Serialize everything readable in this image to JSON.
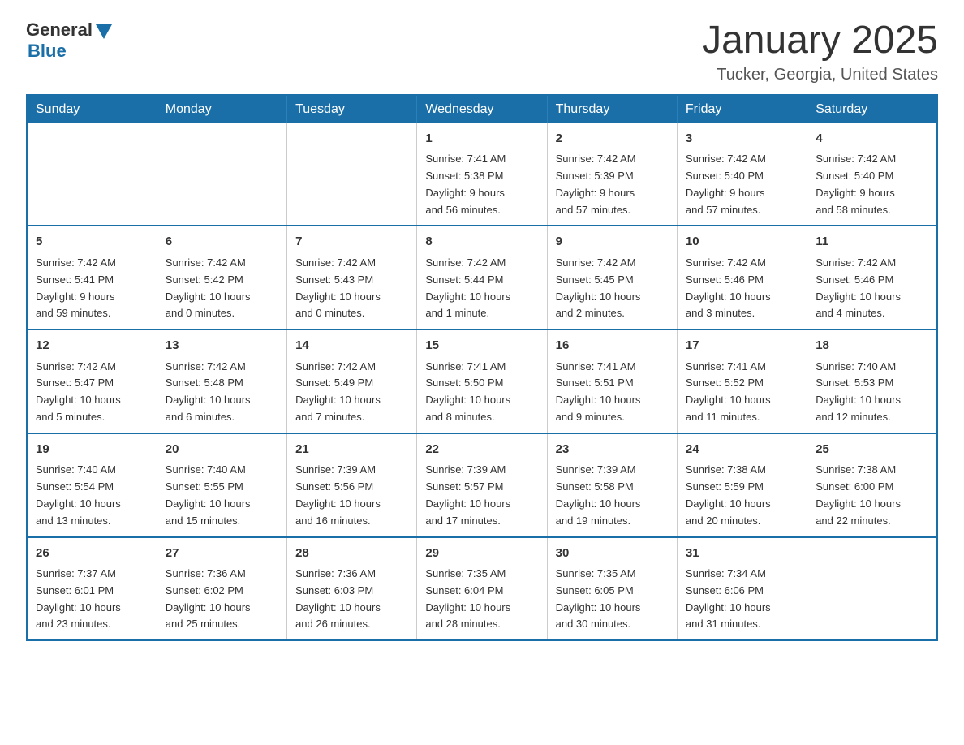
{
  "logo": {
    "general": "General",
    "blue": "Blue"
  },
  "header": {
    "title": "January 2025",
    "location": "Tucker, Georgia, United States"
  },
  "weekdays": [
    "Sunday",
    "Monday",
    "Tuesday",
    "Wednesday",
    "Thursday",
    "Friday",
    "Saturday"
  ],
  "weeks": [
    [
      {
        "day": "",
        "info": ""
      },
      {
        "day": "",
        "info": ""
      },
      {
        "day": "",
        "info": ""
      },
      {
        "day": "1",
        "info": "Sunrise: 7:41 AM\nSunset: 5:38 PM\nDaylight: 9 hours\nand 56 minutes."
      },
      {
        "day": "2",
        "info": "Sunrise: 7:42 AM\nSunset: 5:39 PM\nDaylight: 9 hours\nand 57 minutes."
      },
      {
        "day": "3",
        "info": "Sunrise: 7:42 AM\nSunset: 5:40 PM\nDaylight: 9 hours\nand 57 minutes."
      },
      {
        "day": "4",
        "info": "Sunrise: 7:42 AM\nSunset: 5:40 PM\nDaylight: 9 hours\nand 58 minutes."
      }
    ],
    [
      {
        "day": "5",
        "info": "Sunrise: 7:42 AM\nSunset: 5:41 PM\nDaylight: 9 hours\nand 59 minutes."
      },
      {
        "day": "6",
        "info": "Sunrise: 7:42 AM\nSunset: 5:42 PM\nDaylight: 10 hours\nand 0 minutes."
      },
      {
        "day": "7",
        "info": "Sunrise: 7:42 AM\nSunset: 5:43 PM\nDaylight: 10 hours\nand 0 minutes."
      },
      {
        "day": "8",
        "info": "Sunrise: 7:42 AM\nSunset: 5:44 PM\nDaylight: 10 hours\nand 1 minute."
      },
      {
        "day": "9",
        "info": "Sunrise: 7:42 AM\nSunset: 5:45 PM\nDaylight: 10 hours\nand 2 minutes."
      },
      {
        "day": "10",
        "info": "Sunrise: 7:42 AM\nSunset: 5:46 PM\nDaylight: 10 hours\nand 3 minutes."
      },
      {
        "day": "11",
        "info": "Sunrise: 7:42 AM\nSunset: 5:46 PM\nDaylight: 10 hours\nand 4 minutes."
      }
    ],
    [
      {
        "day": "12",
        "info": "Sunrise: 7:42 AM\nSunset: 5:47 PM\nDaylight: 10 hours\nand 5 minutes."
      },
      {
        "day": "13",
        "info": "Sunrise: 7:42 AM\nSunset: 5:48 PM\nDaylight: 10 hours\nand 6 minutes."
      },
      {
        "day": "14",
        "info": "Sunrise: 7:42 AM\nSunset: 5:49 PM\nDaylight: 10 hours\nand 7 minutes."
      },
      {
        "day": "15",
        "info": "Sunrise: 7:41 AM\nSunset: 5:50 PM\nDaylight: 10 hours\nand 8 minutes."
      },
      {
        "day": "16",
        "info": "Sunrise: 7:41 AM\nSunset: 5:51 PM\nDaylight: 10 hours\nand 9 minutes."
      },
      {
        "day": "17",
        "info": "Sunrise: 7:41 AM\nSunset: 5:52 PM\nDaylight: 10 hours\nand 11 minutes."
      },
      {
        "day": "18",
        "info": "Sunrise: 7:40 AM\nSunset: 5:53 PM\nDaylight: 10 hours\nand 12 minutes."
      }
    ],
    [
      {
        "day": "19",
        "info": "Sunrise: 7:40 AM\nSunset: 5:54 PM\nDaylight: 10 hours\nand 13 minutes."
      },
      {
        "day": "20",
        "info": "Sunrise: 7:40 AM\nSunset: 5:55 PM\nDaylight: 10 hours\nand 15 minutes."
      },
      {
        "day": "21",
        "info": "Sunrise: 7:39 AM\nSunset: 5:56 PM\nDaylight: 10 hours\nand 16 minutes."
      },
      {
        "day": "22",
        "info": "Sunrise: 7:39 AM\nSunset: 5:57 PM\nDaylight: 10 hours\nand 17 minutes."
      },
      {
        "day": "23",
        "info": "Sunrise: 7:39 AM\nSunset: 5:58 PM\nDaylight: 10 hours\nand 19 minutes."
      },
      {
        "day": "24",
        "info": "Sunrise: 7:38 AM\nSunset: 5:59 PM\nDaylight: 10 hours\nand 20 minutes."
      },
      {
        "day": "25",
        "info": "Sunrise: 7:38 AM\nSunset: 6:00 PM\nDaylight: 10 hours\nand 22 minutes."
      }
    ],
    [
      {
        "day": "26",
        "info": "Sunrise: 7:37 AM\nSunset: 6:01 PM\nDaylight: 10 hours\nand 23 minutes."
      },
      {
        "day": "27",
        "info": "Sunrise: 7:36 AM\nSunset: 6:02 PM\nDaylight: 10 hours\nand 25 minutes."
      },
      {
        "day": "28",
        "info": "Sunrise: 7:36 AM\nSunset: 6:03 PM\nDaylight: 10 hours\nand 26 minutes."
      },
      {
        "day": "29",
        "info": "Sunrise: 7:35 AM\nSunset: 6:04 PM\nDaylight: 10 hours\nand 28 minutes."
      },
      {
        "day": "30",
        "info": "Sunrise: 7:35 AM\nSunset: 6:05 PM\nDaylight: 10 hours\nand 30 minutes."
      },
      {
        "day": "31",
        "info": "Sunrise: 7:34 AM\nSunset: 6:06 PM\nDaylight: 10 hours\nand 31 minutes."
      },
      {
        "day": "",
        "info": ""
      }
    ]
  ]
}
